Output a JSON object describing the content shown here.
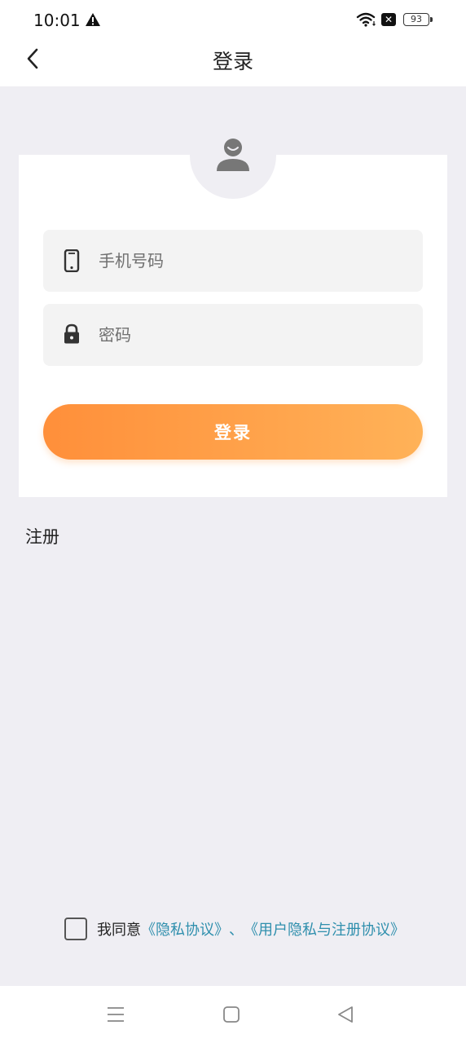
{
  "status_bar": {
    "time": "10:01",
    "battery": "93",
    "icons": [
      "warning-icon",
      "wifi-icon",
      "close-badge-icon",
      "battery-icon"
    ]
  },
  "header": {
    "title": "登录",
    "back_icon": "chevron-left-icon"
  },
  "login_form": {
    "avatar_icon": "user-avatar-icon",
    "phone": {
      "placeholder": "手机号码",
      "value": "",
      "icon": "mobile-phone-icon"
    },
    "password": {
      "placeholder": "密码",
      "value": "",
      "icon": "lock-icon"
    },
    "submit_label": "登录"
  },
  "register_label": "注册",
  "agreement": {
    "prefix": "我同意",
    "privacy_link": "《隐私协议》",
    "separator": "、",
    "terms_link": "《用户隐私与注册协议》",
    "checked": false
  },
  "system_nav": {
    "icons": [
      "menu-icon",
      "home-square-icon",
      "back-triangle-icon"
    ]
  },
  "colors": {
    "accent_start": "#ff8f3a",
    "accent_end": "#ffb258",
    "link": "#2f8fad",
    "background": "#efeef3"
  }
}
